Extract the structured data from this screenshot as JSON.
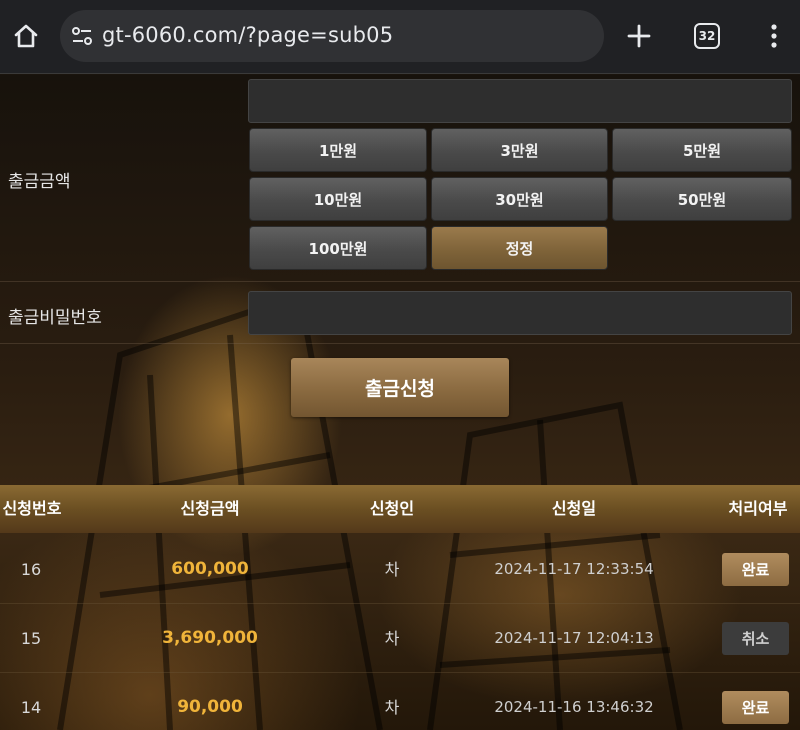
{
  "browser": {
    "url": "gt-6060.com/?page=sub05",
    "tab_count": "32"
  },
  "form": {
    "amount_label": "출금금액",
    "amount_value": "",
    "buttons": [
      "1만원",
      "3만원",
      "5만원",
      "10만원",
      "30만원",
      "50만원",
      "100만원",
      "정정"
    ],
    "password_label": "출금비밀번호",
    "password_value": "",
    "submit_label": "출금신청"
  },
  "table": {
    "headers": [
      "신청번호",
      "신청금액",
      "신청인",
      "신청일",
      "처리여부"
    ],
    "rows": [
      {
        "no": "16",
        "amount": "600,000",
        "applicant": "차",
        "date": "2024-11-17 12:33:54",
        "status": "완료"
      },
      {
        "no": "15",
        "amount": "3,690,000",
        "applicant": "차",
        "date": "2024-11-17 12:04:13",
        "status": "취소"
      },
      {
        "no": "14",
        "amount": "90,000",
        "applicant": "차",
        "date": "2024-11-16 13:46:32",
        "status": "완료"
      }
    ]
  },
  "colors": {
    "accent_gold": "#f0b43a",
    "button_gold": "#8d6c42",
    "header_bar": "#6b4f22"
  },
  "icons": {
    "home": "home-icon",
    "site_settings": "tune-icon",
    "new_tab": "plus-icon",
    "tabs": "tabs-icon",
    "menu": "more-vert-icon"
  }
}
